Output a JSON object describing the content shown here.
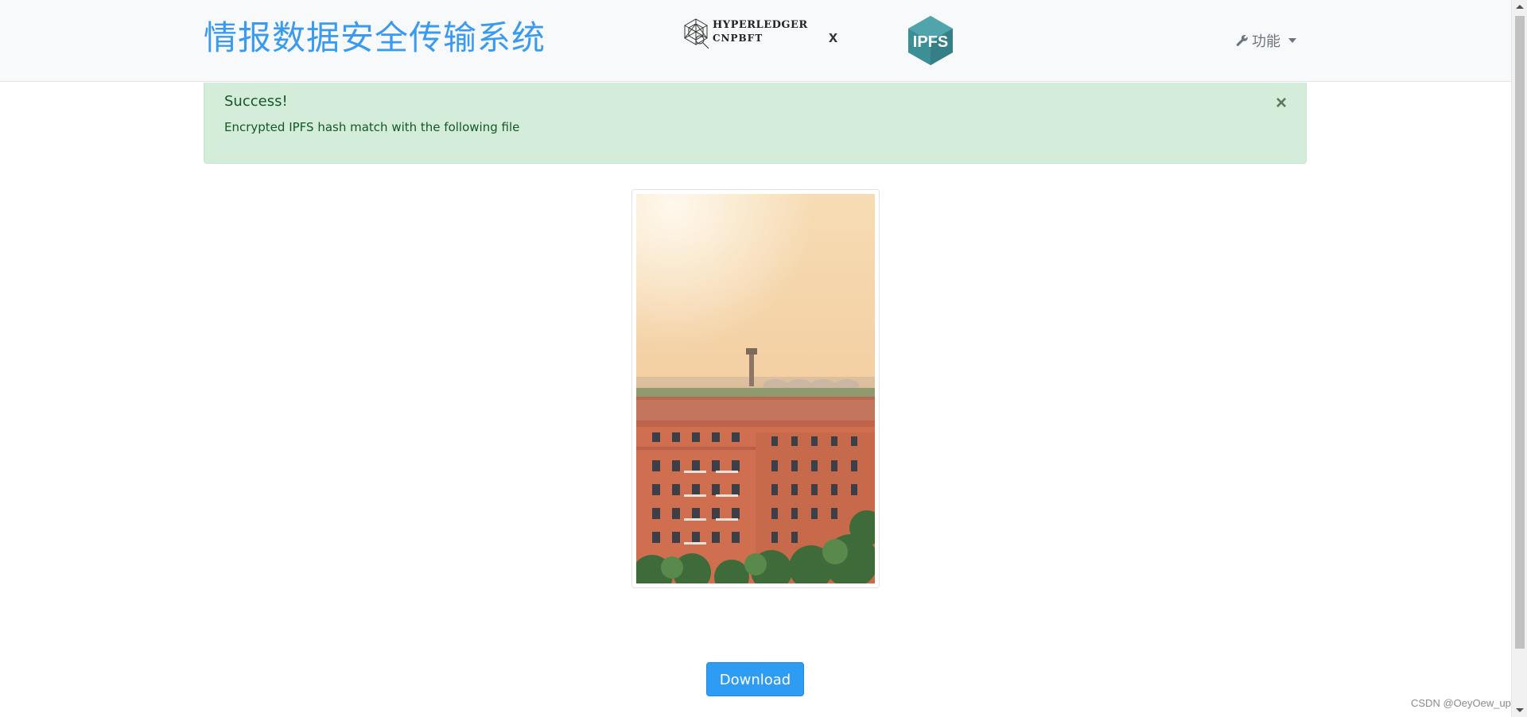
{
  "navbar": {
    "brand": "情报数据安全传输系统",
    "hyperledger_line1": "HYPERLEDGER",
    "hyperledger_line2": "CNPBFT",
    "cross": "x",
    "ipfs_text": "IPFS",
    "function_menu": "功能"
  },
  "alert": {
    "heading": "Success!",
    "message": "Encrypted IPFS hash match with the following file",
    "close": "×"
  },
  "file_preview": {
    "alt": "building photo"
  },
  "download_button": "Download",
  "watermark": "CSDN @OeyOew_up",
  "colors": {
    "brand": "#3a9af0",
    "alert_bg": "#d4edda",
    "alert_text": "#155724",
    "button": "#2f9cf4",
    "ipfs": "#3d8f96"
  },
  "icons": {
    "function_menu": "wrench-icon",
    "alert_close": "close-icon",
    "menu_caret": "caret-down-icon"
  }
}
